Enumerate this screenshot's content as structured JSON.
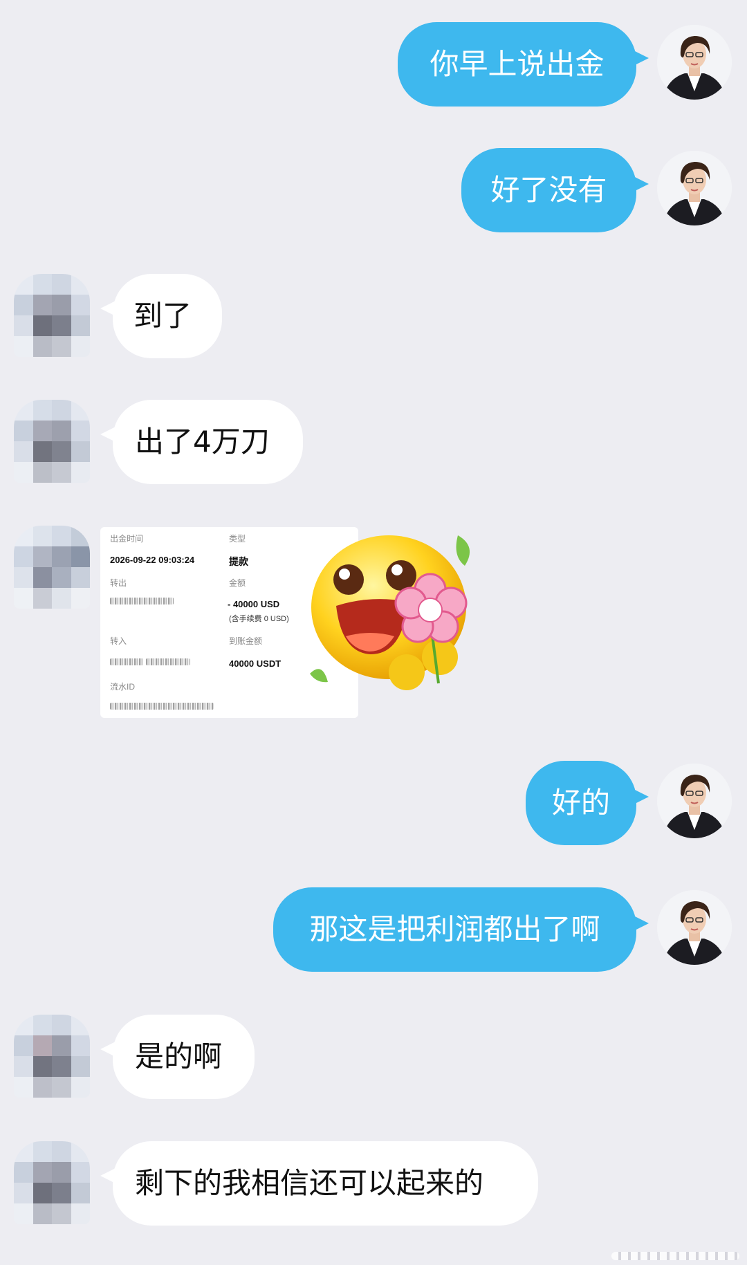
{
  "messages": {
    "m1": "你早上说出金",
    "m2": "好了没有",
    "m3": "到了",
    "m4": "出了4万刀",
    "m6": "好的",
    "m7": "那这是把利润都出了啊",
    "m8": "是的啊",
    "m9": "剩下的我相信还可以起来的"
  },
  "receipt": {
    "time_label": "出金时间",
    "time_value": "2026-09-22 09:03:24",
    "type_label": "类型",
    "type_value": "提款",
    "out_label": "转出",
    "amount_label": "金额",
    "amount_value": "- 40000 USD",
    "fee_note": "(含手续费 0 USD)",
    "in_label": "转入",
    "received_label": "到账金额",
    "received_value": "40000 USDT",
    "flow_label": "流水ID"
  },
  "colors": {
    "background": "#ededf2",
    "my_bubble": "#3eb8ee",
    "their_bubble": "#ffffff"
  },
  "icons": {
    "my_avatar": "woman-portrait-avatar",
    "their_avatar": "pixelated-avatar",
    "sticker": "smiley-with-flower-sticker"
  }
}
